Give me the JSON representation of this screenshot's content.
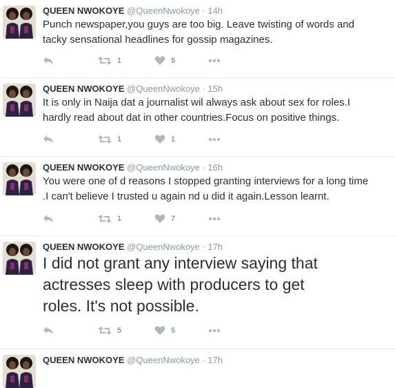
{
  "tweets": [
    {
      "name": "QUEEN NWOKOYE",
      "handle": "@QueenNwokoye",
      "dot": "·",
      "time": "14h",
      "text": "Punch newspaper,you guys are too big. Leave twisting of words and\ntacky sensational headlines for gossip magazines.",
      "retweets": "1",
      "likes": "5"
    },
    {
      "name": "QUEEN NWOKOYE",
      "handle": "@QueenNwokoye",
      "dot": "·",
      "time": "15h",
      "text": "It is only in Naija dat a journalist wil always ask about sex for roles.I\nhardly read about dat in other countries.Focus on positive things.",
      "retweets": "1",
      "likes": "1"
    },
    {
      "name": "QUEEN NWOKOYE",
      "handle": "@QueenNwokoye",
      "dot": "·",
      "time": "16h",
      "text": "You were one of d reasons I stopped granting interviews for a long time\n.I can't believe I trusted u again nd u did it again.Lesson learnt.",
      "retweets": "1",
      "likes": "7"
    },
    {
      "name": "QUEEN NWOKOYE",
      "handle": "@QueenNwokoye",
      "dot": "·",
      "time": "17h",
      "text": "I did not grant any interview saying that\nactresses sleep with producers to get\nroles. It's not possible.",
      "retweets": "5",
      "likes": "5"
    },
    {
      "name": "QUEEN NWOKOYE",
      "handle": "@QueenNwokoye",
      "dot": "·",
      "time": "17h"
    }
  ],
  "icons": {
    "reply": "reply-icon",
    "retweet": "retweet-icon",
    "like": "heart-icon",
    "more": "more-icon"
  },
  "colors": {
    "name": "#292f33",
    "meta": "#8899a6",
    "icon": "#aab8c2",
    "divider": "#e1e8ed"
  }
}
